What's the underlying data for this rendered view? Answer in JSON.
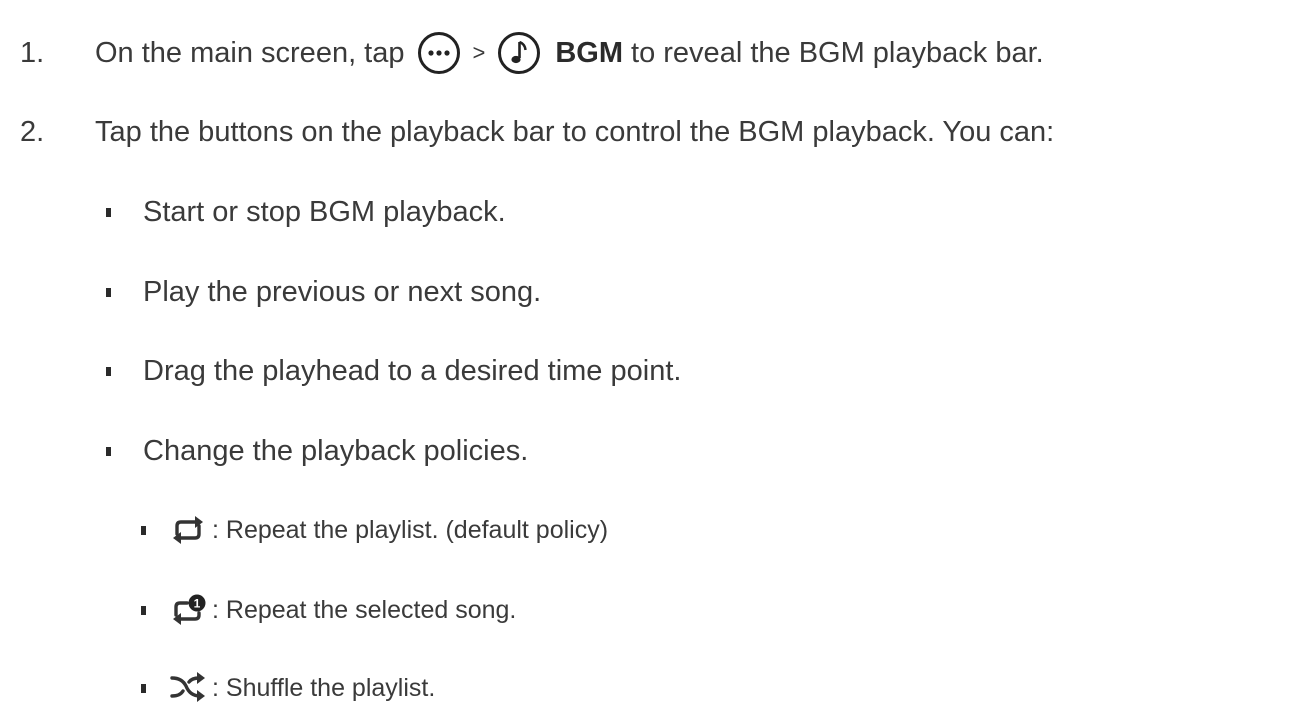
{
  "steps": [
    {
      "number": "1.",
      "text_before": "On the main screen, tap",
      "separator": ">",
      "bold": "BGM",
      "text_after": "to reveal the BGM playback bar.",
      "icons": [
        "more-icon",
        "music-note-icon"
      ]
    },
    {
      "number": "2.",
      "text": "Tap the buttons on the playback bar to control the BGM playback. You can:",
      "items": [
        "Start or stop BGM playback.",
        "Play the previous or next song.",
        "Drag the playhead to a desired time point.",
        "Change the playback policies."
      ],
      "policies": [
        {
          "icon": "repeat-icon",
          "text": ": Repeat the playlist. (default policy)"
        },
        {
          "icon": "repeat-one-icon",
          "text": ": Repeat the selected song."
        },
        {
          "icon": "shuffle-icon",
          "text": ": Shuffle the playlist."
        }
      ]
    }
  ]
}
